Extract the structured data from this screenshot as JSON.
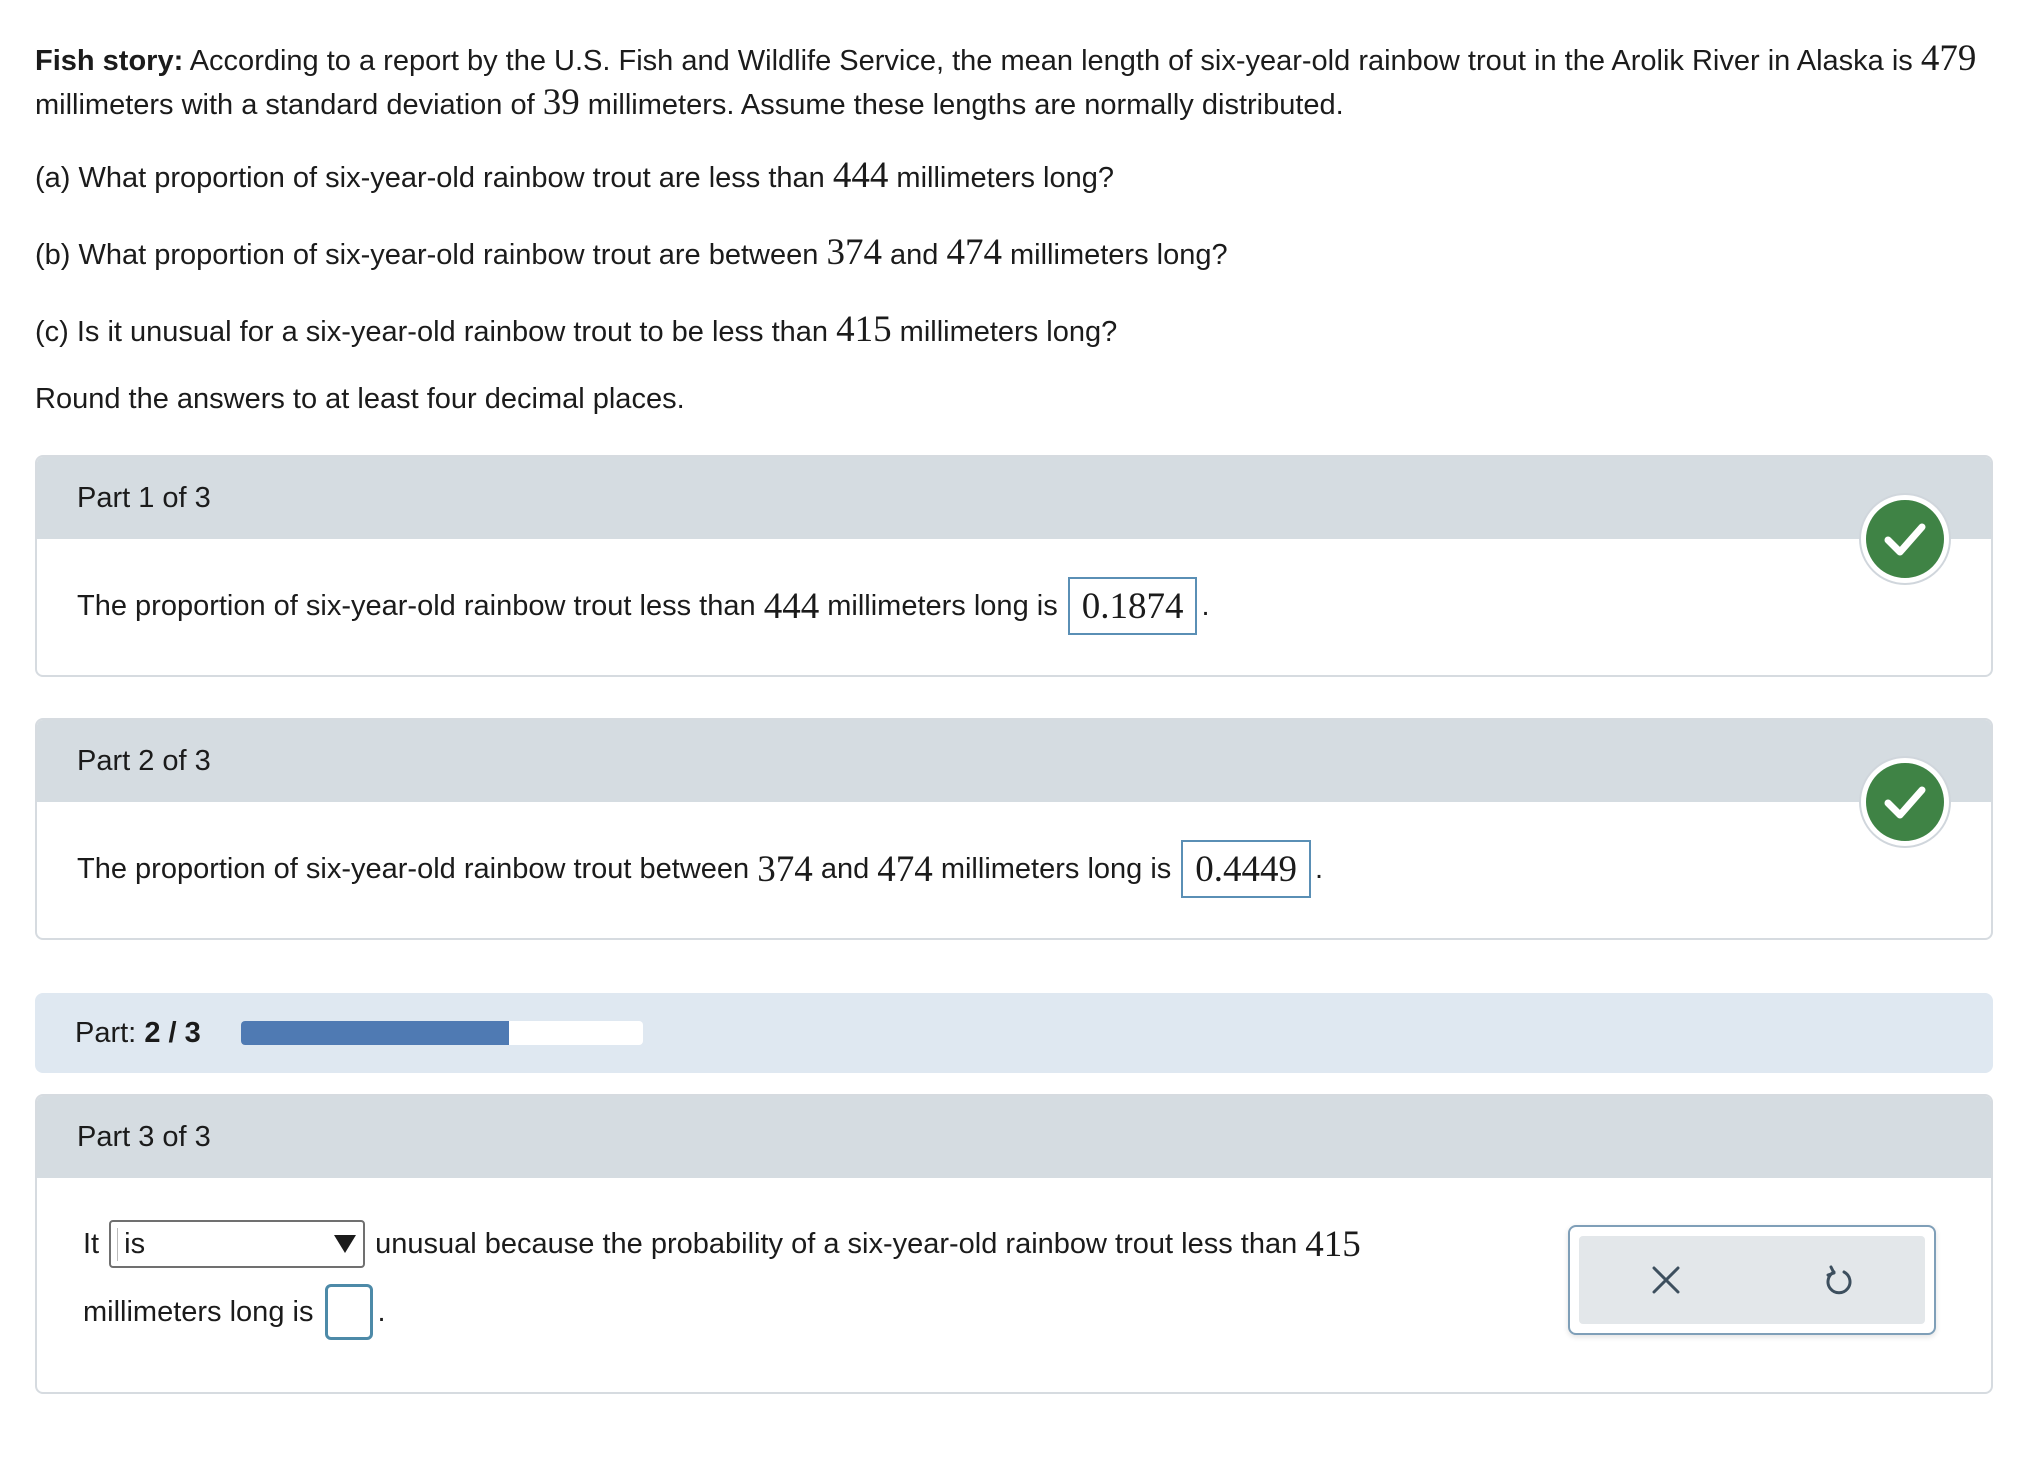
{
  "problem": {
    "title": "Fish story:",
    "text_1": "According to a report by the U.S. Fish and Wildlife Service, the mean length of six-year-old rainbow trout in the Arolik River in Alaska is",
    "mean": "479",
    "text_2": "millimeters with a standard deviation of",
    "sd": "39",
    "text_3": "millimeters. Assume these lengths are normally distributed.",
    "qa_prefix": "(a) What proportion of six-year-old rainbow trout are less than",
    "qa_num": "444",
    "qa_suffix": "millimeters long?",
    "qb_prefix": "(b) What proportion of six-year-old rainbow trout are between",
    "qb_num1": "374",
    "qb_and": "and",
    "qb_num2": "474",
    "qb_suffix": "millimeters long?",
    "qc_prefix": "(c) Is it unusual for a six-year-old rainbow trout to be less than",
    "qc_num": "415",
    "qc_suffix": "millimeters long?",
    "round_note": "Round the answers to at least four decimal places."
  },
  "part1": {
    "header": "Part 1 of 3",
    "prefix": "The proportion of six-year-old rainbow trout less than",
    "num": "444",
    "suffix": "millimeters long is",
    "answer": "0.1874",
    "end": ".",
    "status_icon": "check-icon"
  },
  "part2": {
    "header": "Part 2 of 3",
    "prefix": "The proportion of six-year-old rainbow trout between",
    "num1": "374",
    "and": "and",
    "num2": "474",
    "suffix": "millimeters long is",
    "answer": "0.4449",
    "end": ".",
    "status_icon": "check-icon"
  },
  "progress": {
    "label": "Part:",
    "value": "2 / 3",
    "fraction": 0.667
  },
  "part3": {
    "header": "Part 3 of 3",
    "lead": "It",
    "select_value": "is",
    "middle": "unusual because the probability of a six-year-old rainbow trout less than",
    "num": "415",
    "line2": "millimeters long is",
    "end": "."
  },
  "tools": {
    "clear_icon": "close-icon",
    "reset_icon": "undo-icon"
  },
  "colors": {
    "check": "#3f8345",
    "progress_fill": "#4f7ab3",
    "card_header": "#d5dce1",
    "progress_bg": "#dfe8f1"
  }
}
